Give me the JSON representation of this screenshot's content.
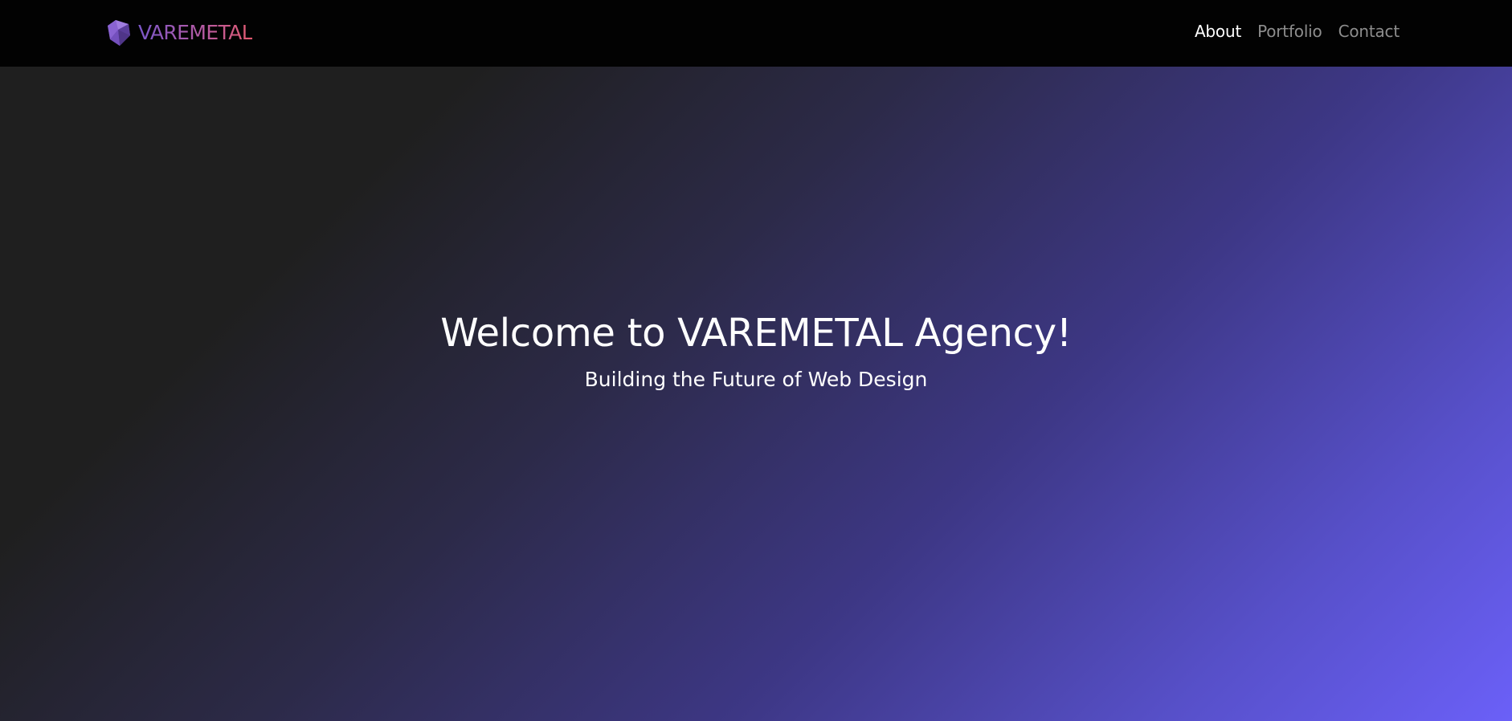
{
  "brand": {
    "name": "VAREMETAL",
    "icon": "gem-logo-icon",
    "gradient": [
      "#7a57c8",
      "#e0596e"
    ]
  },
  "nav": {
    "items": [
      {
        "label": "About",
        "active": true
      },
      {
        "label": "Portfolio",
        "active": false
      },
      {
        "label": "Contact",
        "active": false
      }
    ]
  },
  "hero": {
    "title": "Welcome to VAREMETAL Agency!",
    "subtitle": "Building the Future of Web Design",
    "gradient": [
      "#1f1f1f",
      "#6b60f8"
    ]
  },
  "colors": {
    "navbar_bg": "#020202",
    "nav_active": "#ffffff",
    "nav_inactive": "#8d8d8d"
  }
}
